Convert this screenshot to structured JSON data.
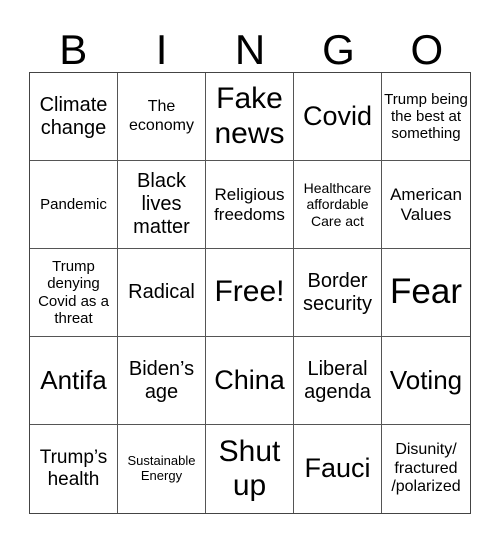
{
  "header": [
    "B",
    "I",
    "N",
    "G",
    "O"
  ],
  "cells": [
    "Climate change",
    "The economy",
    "Fake news",
    "Covid",
    "Trump being the best at something",
    "Pandemic",
    "Black lives matter",
    "Religious freedoms",
    "Healthcare affordable Care act",
    "American Values",
    "Trump denying Covid as a threat",
    "Radical",
    "Free!",
    "Border security",
    "Fear",
    "Antifa",
    "Biden’s age",
    "China",
    "Liberal agenda",
    "Voting",
    "Trump’s health",
    "Sustainable Energy",
    "Shut up",
    "Fauci",
    "Disunity/ fractured /polarized"
  ]
}
